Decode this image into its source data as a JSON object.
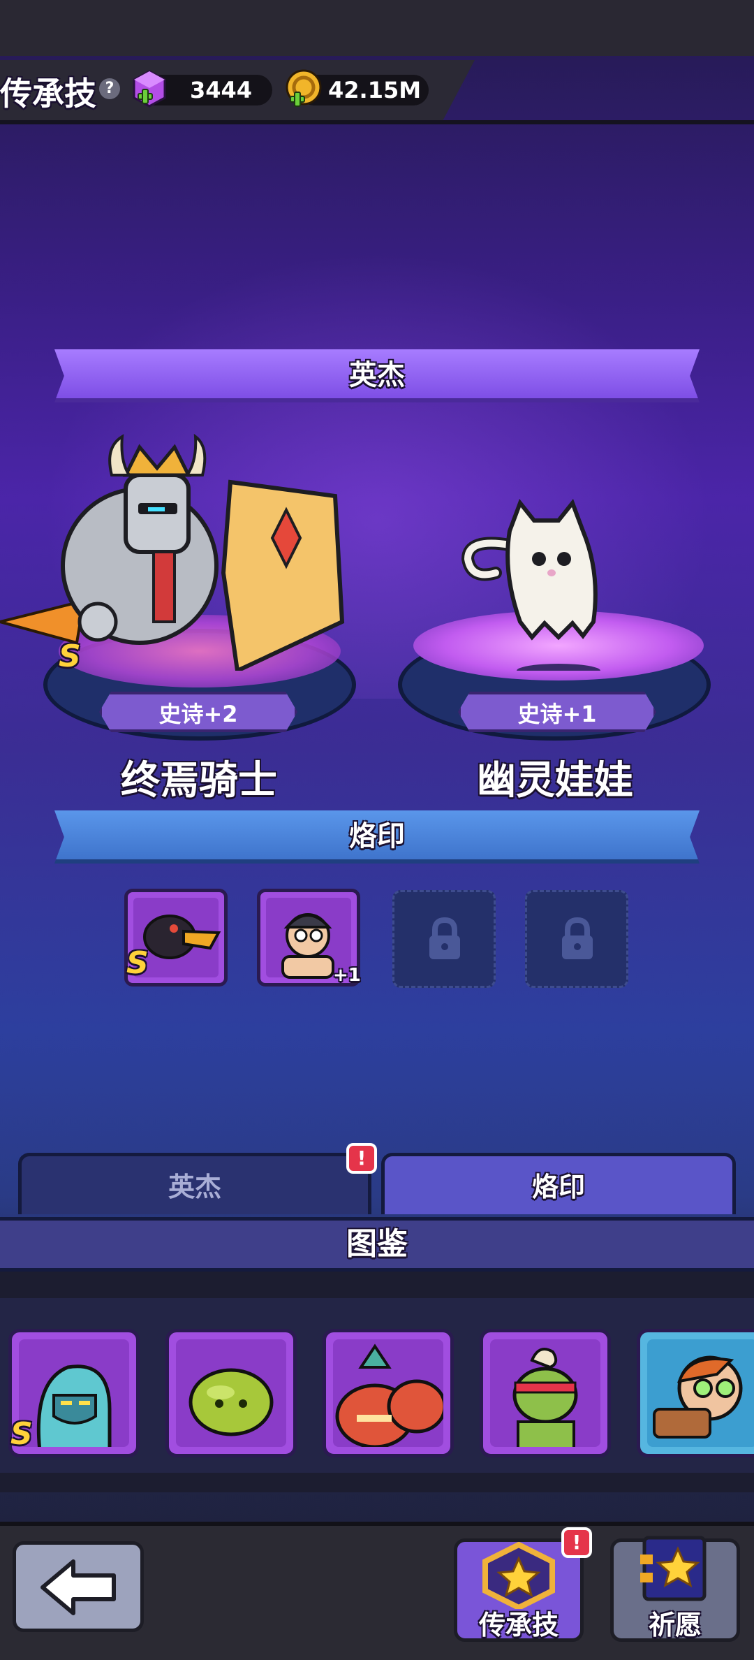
{
  "header": {
    "title": "传承技",
    "help_icon": "question-icon",
    "gems": "3444",
    "gold": "42.15M"
  },
  "heroes_section": {
    "banner": "英杰",
    "heroes": [
      {
        "name": "终焉骑士",
        "rarity": "史诗+2",
        "grade": "S"
      },
      {
        "name": "幽灵娃娃",
        "rarity": "史诗+1"
      }
    ]
  },
  "imprint_section": {
    "banner": "烙印",
    "slots": [
      {
        "grade": "S"
      },
      {
        "level": "+1"
      }
    ]
  },
  "tabs": {
    "heroes": "英杰",
    "imprint": "烙印",
    "alert": "!"
  },
  "catalog": {
    "title": "图鉴",
    "first_grade": "S"
  },
  "bottom": {
    "legacy_label": "传承技",
    "wish_label": "祈愿",
    "alert": "!"
  },
  "colors": {
    "hero_banner": "#8b5cf0",
    "imprint_banner": "#4a86d8",
    "card_purple": "#a14ee0"
  }
}
